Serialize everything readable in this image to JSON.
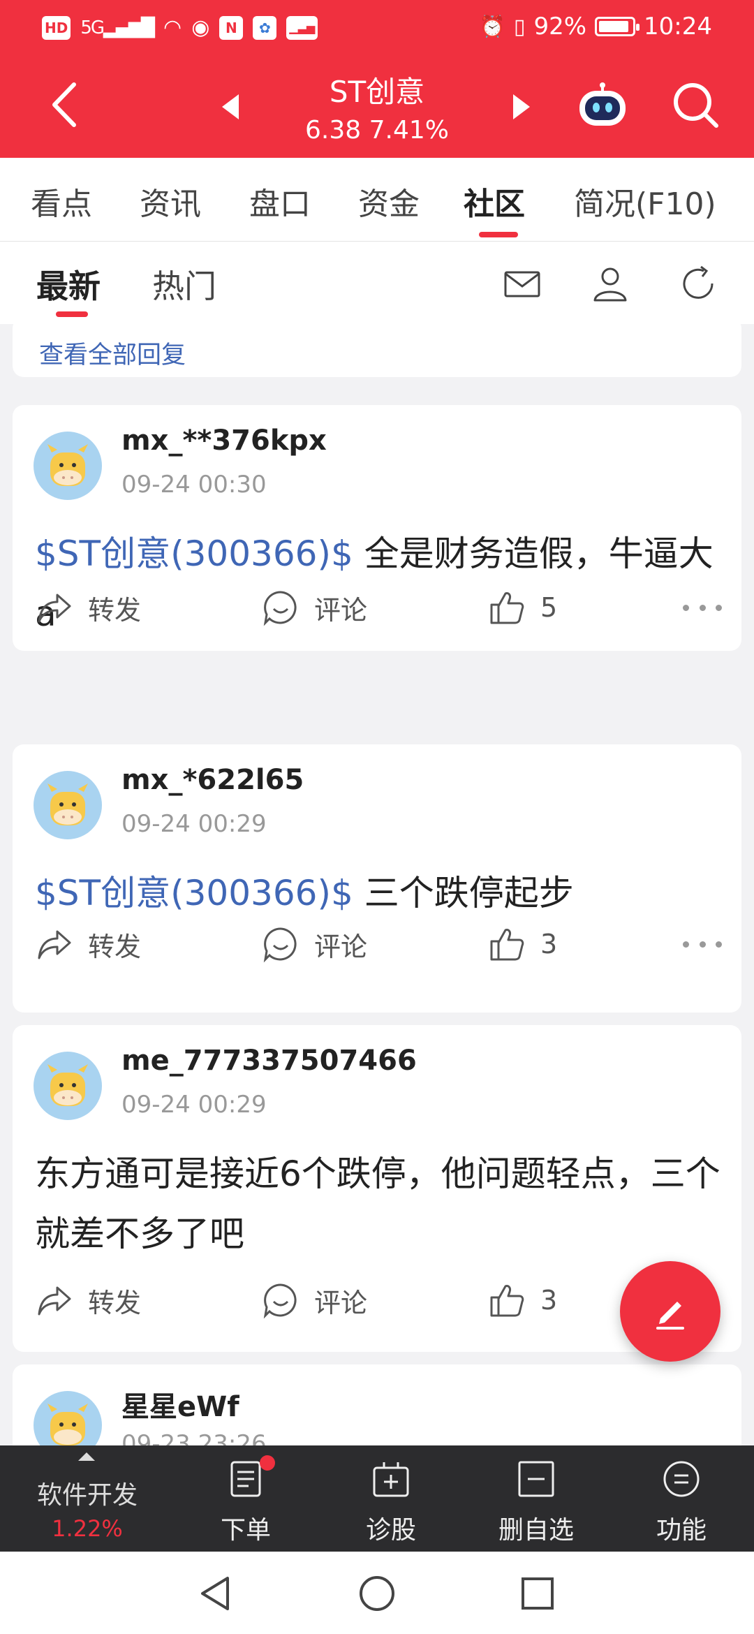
{
  "colors": {
    "brand_red": "#f0303f",
    "link_blue": "#3f66b5",
    "dark_bar": "#2c2c2e"
  },
  "status_bar": {
    "left_icons": [
      "HD",
      "5G",
      "signal",
      "wifi",
      "eye",
      "N",
      "app",
      "stock"
    ],
    "hd": "HD",
    "signal": "5G",
    "battery_percent": "92%",
    "battery_level": 0.92,
    "time": "10:24"
  },
  "header": {
    "title": "ST创意",
    "price_change": "6.38 7.41%",
    "icons": [
      "back-icon",
      "prev-stock-icon",
      "next-stock-icon",
      "robot-assistant-icon",
      "search-icon"
    ]
  },
  "tabs": [
    {
      "label": "看点"
    },
    {
      "label": "资讯"
    },
    {
      "label": "盘口"
    },
    {
      "label": "资金"
    },
    {
      "label": "社区",
      "active": true
    },
    {
      "label": "简况(F10)"
    }
  ],
  "subtabs": {
    "items": [
      {
        "label": "最新",
        "active": true
      },
      {
        "label": "热门"
      }
    ],
    "icons": [
      "mail-icon",
      "user-icon",
      "refresh-icon"
    ]
  },
  "feed": {
    "view_all_replies": "查看全部回复",
    "posts": [
      {
        "user": "mx_**376kpx",
        "time": "09-24 00:30",
        "tag": "$ST创意(300366)$",
        "text": " 全是财务造假，牛逼大a",
        "forward": "转发",
        "comment": "评论",
        "likes": "5"
      },
      {
        "user": "mx_*622l65",
        "time": "09-24 00:29",
        "tag": "$ST创意(300366)$",
        "text": " 三个跌停起步",
        "forward": "转发",
        "comment": "评论",
        "likes": "3"
      },
      {
        "user": "me_777337507466",
        "time": "09-24 00:29",
        "tag": "",
        "text": "东方通可是接近6个跌停，他问题轻点，三个就差不多了吧",
        "forward": "转发",
        "comment": "评论",
        "likes": "3"
      },
      {
        "user": "星星eWf",
        "time": "09-23 23:26"
      }
    ]
  },
  "bottom_bar": {
    "stock_name": "软件开发",
    "stock_pct": "1.22%",
    "items": [
      {
        "label": "下单",
        "icon": "order-icon",
        "badge": true
      },
      {
        "label": "诊股",
        "icon": "diagnose-icon"
      },
      {
        "label": "删自选",
        "icon": "remove-watchlist-icon"
      },
      {
        "label": "功能",
        "icon": "menu-icon"
      }
    ]
  },
  "system_nav": [
    "back-triangle-icon",
    "home-circle-icon",
    "recents-square-icon"
  ]
}
